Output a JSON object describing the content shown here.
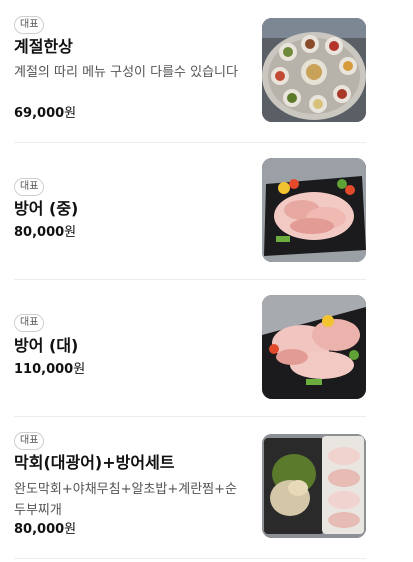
{
  "menu": {
    "items": [
      {
        "badge": "대표",
        "name": "계절한상",
        "description": "계절의 따리 메뉴 구성이 다를수 있습니다",
        "price": "69,000",
        "currency": "원",
        "image": "platter-of-side-dishes"
      },
      {
        "badge": "대표",
        "name": "방어 (중)",
        "description": "",
        "price": "80,000",
        "currency": "원",
        "image": "yellowtail-sashimi-medium"
      },
      {
        "badge": "대표",
        "name": "방어 (대)",
        "description": "",
        "price": "110,000",
        "currency": "원",
        "image": "yellowtail-sashimi-large"
      },
      {
        "badge": "대표",
        "name": "막회(대광어)+방어세트",
        "description": "완도막회+야채무침+알초밥+계란찜+순두부찌개",
        "price": "80,000",
        "currency": "원",
        "image": "mixed-sashimi-set"
      }
    ]
  }
}
